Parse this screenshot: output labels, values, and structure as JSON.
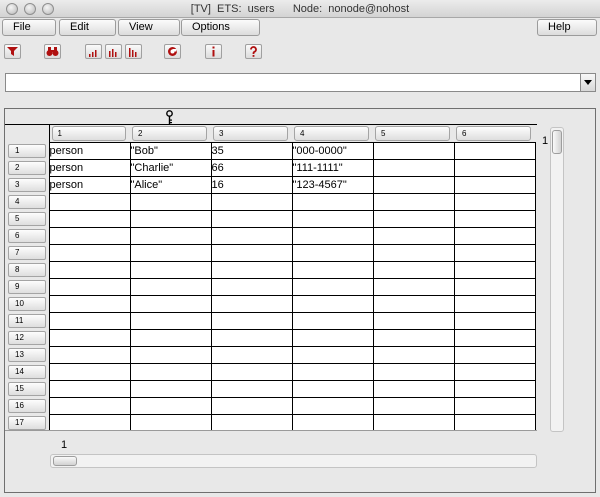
{
  "window": {
    "title": "[TV]  ETS:  users      Node:  nonode@nohost"
  },
  "menu": {
    "file": "File",
    "edit": "Edit",
    "view": "View",
    "options": "Options",
    "help": "Help"
  },
  "toolbar": {
    "icons": [
      "filter-icon",
      "binoculars-icon",
      "bar-chart-small-icon",
      "bar-chart-medium-icon",
      "bar-chart-large-icon",
      "refresh-icon",
      "info-icon",
      "help-icon"
    ]
  },
  "search": {
    "value": ""
  },
  "table": {
    "columns": [
      "1",
      "2",
      "3",
      "4",
      "5",
      "6"
    ],
    "row_numbers": [
      "1",
      "2",
      "3",
      "4",
      "5",
      "6",
      "7",
      "8",
      "9",
      "10",
      "11",
      "12",
      "13",
      "14",
      "15",
      "16",
      "17"
    ],
    "rows": [
      [
        "person",
        "\"Bob\"",
        "35",
        "\"000-0000\"",
        "",
        ""
      ],
      [
        "person",
        "\"Charlie\"",
        "66",
        "\"111-1111\"",
        "",
        ""
      ],
      [
        "person",
        "\"Alice\"",
        "16",
        "\"123-4567\"",
        "",
        ""
      ]
    ],
    "vertical_position_label": "1",
    "horizontal_position_label": "1"
  },
  "colors": {
    "icon_red": "#b01010",
    "grid_line": "#000000",
    "background": "#e8e8e8"
  }
}
